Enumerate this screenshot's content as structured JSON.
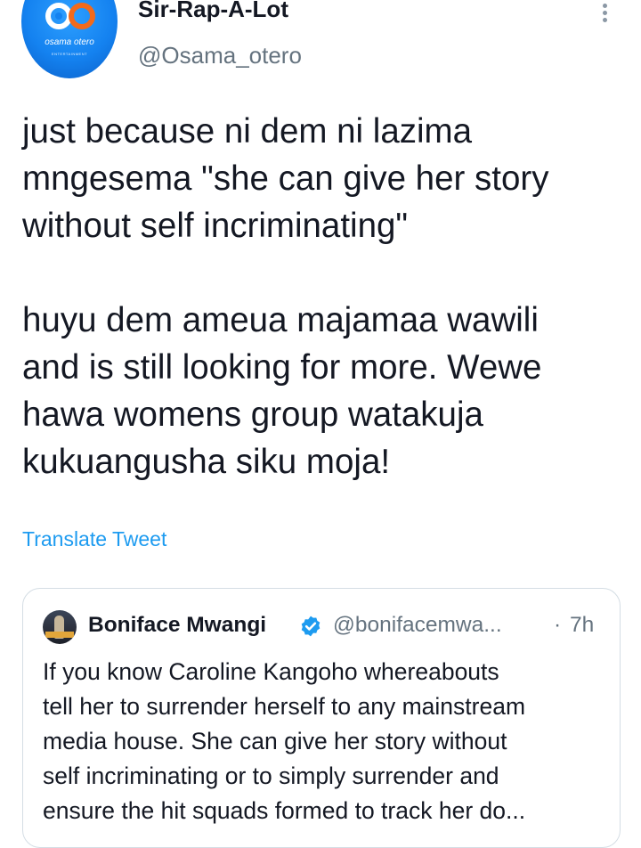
{
  "tweet": {
    "author": {
      "display_name": "Sir-Rap-A-Lot",
      "handle": "@Osama_otero",
      "avatar_text": "osama otero",
      "avatar_subtext": "ENTERTAINMENT"
    },
    "text_paragraphs": [
      "just because ni dem ni lazima\nmngesema \"she can give her story\nwithout self incriminating\"",
      "huyu dem ameua majamaa wawili\nand is still looking for more. Wewe\nhawa womens group watakuja\nkukuangusha siku moja!"
    ],
    "translate_label": "Translate Tweet",
    "more_icon": "more-vertical-icon"
  },
  "quoted_tweet": {
    "display_name": "Boniface Mwangi",
    "verified": true,
    "handle": "@bonifacemwa...",
    "separator": "·",
    "time": "7h",
    "text": "If you know Caroline Kangoho whereabouts\ntell her to surrender herself to any mainstream\nmedia house. She can give her story without\nself incriminating or to simply surrender and\nensure the hit squads formed to track her do..."
  },
  "colors": {
    "link": "#1d9bf0",
    "secondary_text": "#65737f",
    "verified": "#1d9bf0",
    "card_border": "#d4dde4"
  }
}
